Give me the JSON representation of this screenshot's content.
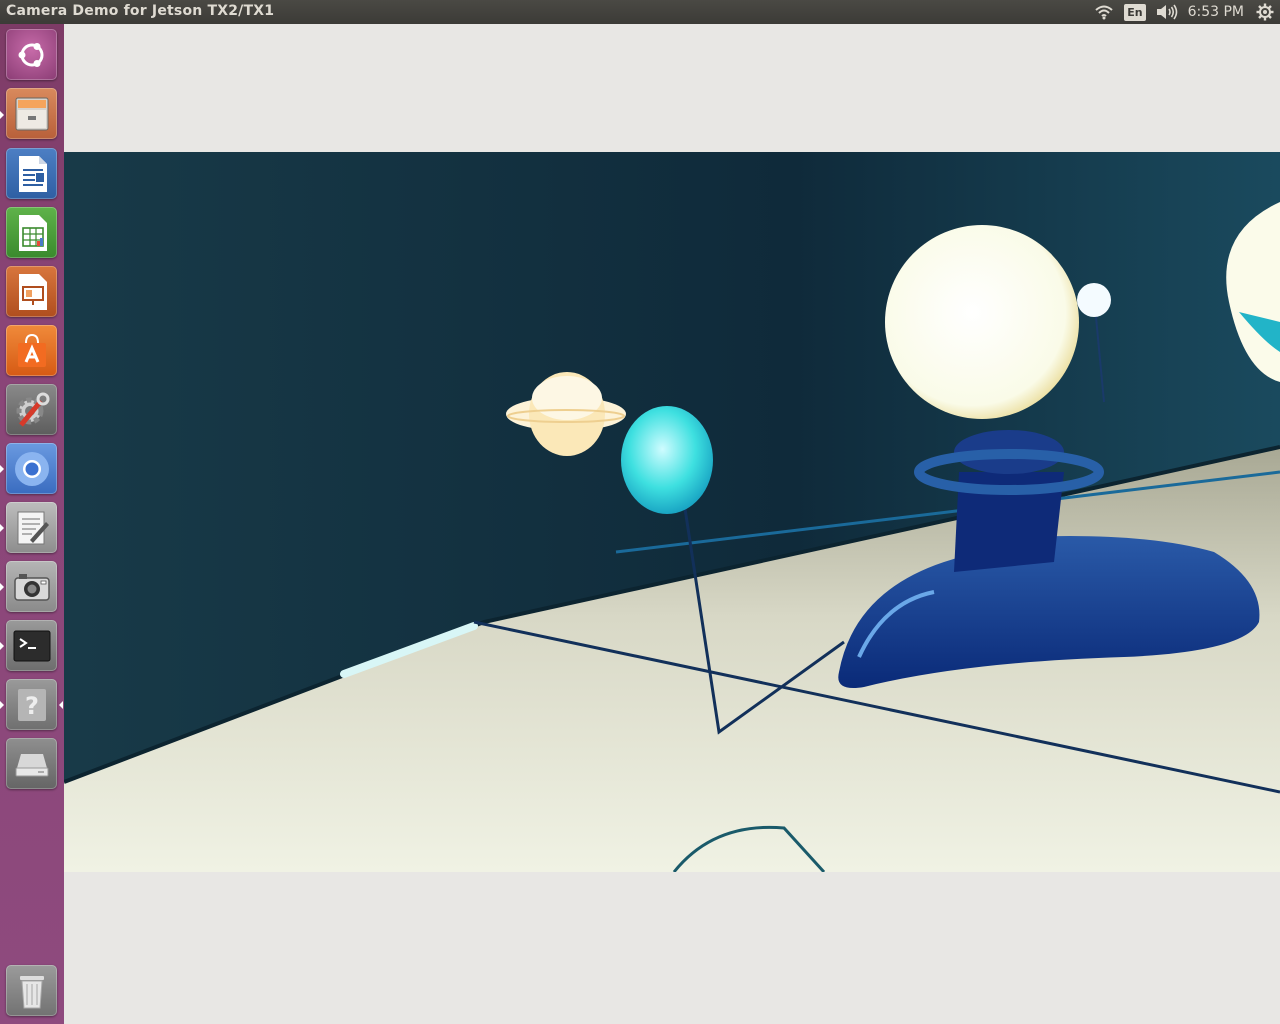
{
  "window": {
    "title": "Camera Demo for Jetson TX2/TX1"
  },
  "panel": {
    "wifi_icon": "wifi-icon",
    "keyboard_layout": "En",
    "volume_icon": "volume-icon",
    "clock": "6:53 PM",
    "system_icon": "gear-icon"
  },
  "launcher": {
    "items": [
      {
        "name": "ubuntu-dash",
        "icon": "ubuntu-logo-icon"
      },
      {
        "name": "files",
        "icon": "file-cabinet-icon"
      },
      {
        "name": "libreoffice-writer",
        "icon": "writer-document-icon"
      },
      {
        "name": "libreoffice-calc",
        "icon": "calc-spreadsheet-icon"
      },
      {
        "name": "libreoffice-impress",
        "icon": "impress-presentation-icon"
      },
      {
        "name": "ubuntu-software",
        "icon": "software-bag-icon"
      },
      {
        "name": "system-settings",
        "icon": "settings-gear-wrench-icon"
      },
      {
        "name": "chromium",
        "icon": "chromium-icon"
      },
      {
        "name": "text-editor",
        "icon": "text-editor-icon"
      },
      {
        "name": "camera-demo",
        "icon": "camera-icon"
      },
      {
        "name": "terminal",
        "icon": "terminal-icon"
      },
      {
        "name": "help",
        "icon": "help-icon"
      },
      {
        "name": "drive",
        "icon": "drive-icon"
      },
      {
        "name": "trash",
        "icon": "trash-icon"
      }
    ]
  },
  "colors": {
    "launcher_bg": "#8a4577",
    "panel_bg": "#3c3b37",
    "content_bg": "#e8e7e4"
  }
}
